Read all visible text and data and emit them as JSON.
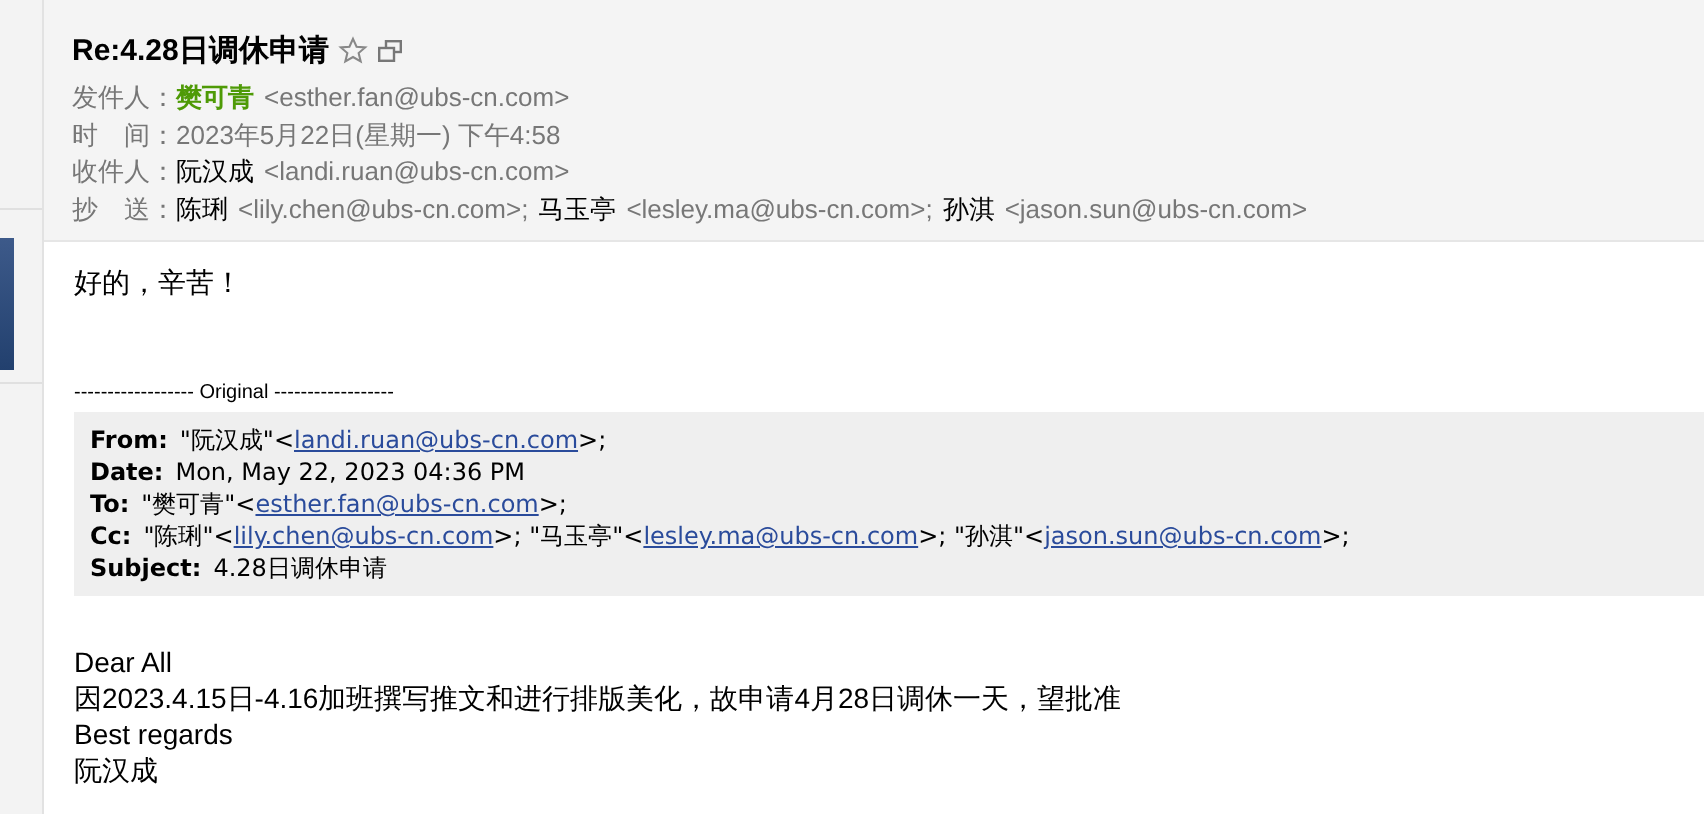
{
  "sidebar": {
    "tab_selected": true
  },
  "header": {
    "title": "Re:4.28日调休申请",
    "starred": false,
    "rows": [
      {
        "label": "发件人：",
        "kind": "people",
        "people": [
          {
            "name": "樊可青",
            "address": "<esther.fan@ubs-cn.com>",
            "sender": true
          }
        ]
      },
      {
        "label": "时　间：",
        "kind": "text",
        "value": "2023年5月22日(星期一) 下午4:58"
      },
      {
        "label": "收件人：",
        "kind": "people",
        "people": [
          {
            "name": "阮汉成",
            "address": "<landi.ruan@ubs-cn.com>",
            "sender": false
          }
        ]
      },
      {
        "label": "抄　送：",
        "kind": "people",
        "people": [
          {
            "name": "陈琍",
            "address": "<lily.chen@ubs-cn.com>;",
            "sender": false
          },
          {
            "name": "马玉亭",
            "address": "<lesley.ma@ubs-cn.com>;",
            "sender": false
          },
          {
            "name": "孙淇",
            "address": "<jason.sun@ubs-cn.com>",
            "sender": false
          }
        ]
      }
    ]
  },
  "reply": "好的，辛苦！",
  "separator": "------------------ Original ------------------",
  "quote": [
    {
      "label": "From:",
      "segments": [
        {
          "text": "\"阮汉成\"<"
        },
        {
          "link": "landi.ruan@ubs-cn.com"
        },
        {
          "text": ">;"
        }
      ]
    },
    {
      "label": "Date:",
      "segments": [
        {
          "text": "Mon, May 22, 2023 04:36 PM"
        }
      ]
    },
    {
      "label": "To:",
      "segments": [
        {
          "text": "\"樊可青\"<"
        },
        {
          "link": "esther.fan@ubs-cn.com"
        },
        {
          "text": ">;"
        }
      ]
    },
    {
      "label": "Cc:",
      "segments": [
        {
          "text": "\"陈琍\"<"
        },
        {
          "link": "lily.chen@ubs-cn.com"
        },
        {
          "text": ">; \"马玉亭\"<"
        },
        {
          "link": "lesley.ma@ubs-cn.com"
        },
        {
          "text": ">; \"孙淇\"<"
        },
        {
          "link": "jason.sun@ubs-cn.com"
        },
        {
          "text": ">;"
        }
      ]
    },
    {
      "label": "Subject:",
      "segments": [
        {
          "text": "4.28日调休申请"
        }
      ]
    }
  ],
  "body": [
    "Dear All",
    "因2023.4.15日-4.16加班撰写推文和进行排版美化，故申请4月28日调休一天，望批准",
    "Best regards",
    "阮汉成"
  ]
}
